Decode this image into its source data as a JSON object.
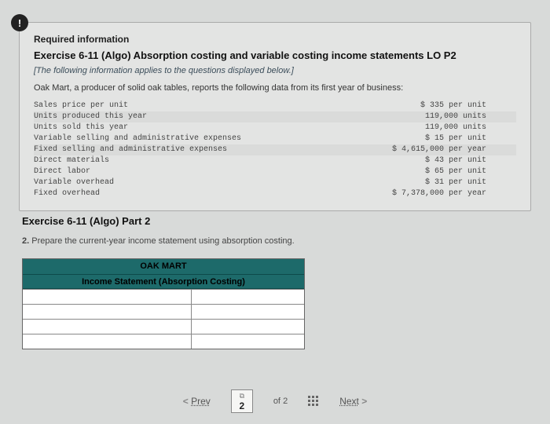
{
  "info": {
    "required": "Required information",
    "title": "Exercise 6-11 (Algo) Absorption costing and variable costing income statements LO P2",
    "note": "[The following information applies to the questions displayed below.]",
    "body": "Oak Mart, a producer of solid oak tables, reports the following data from its first year of business:",
    "rows": [
      {
        "label": "Sales price per unit",
        "value": "$ 335 per unit"
      },
      {
        "label": "Units produced this year",
        "value": "119,000 units"
      },
      {
        "label": "Units sold this year",
        "value": "119,000 units"
      },
      {
        "label": "Variable selling and administrative expenses",
        "value": "$ 15 per unit"
      },
      {
        "label": "Fixed selling and administrative expenses",
        "value": "$ 4,615,000 per year"
      },
      {
        "label": "Direct materials",
        "value": "$ 43 per unit"
      },
      {
        "label": "Direct labor",
        "value": "$ 65 per unit"
      },
      {
        "label": "Variable overhead",
        "value": "$ 31 per unit"
      },
      {
        "label": "Fixed overhead",
        "value": "$ 7,378,000 per year"
      }
    ]
  },
  "part2": {
    "title": "Exercise 6-11 (Algo) Part 2",
    "instruction_prefix": "2. ",
    "instruction": "Prepare the current-year income statement using absorption costing.",
    "ws_header1": "OAK MART",
    "ws_header2": "Income Statement (Absorption Costing)"
  },
  "pager": {
    "prev": "Prev",
    "current": "2",
    "of": "of",
    "total": "2",
    "next": "Next",
    "link_icon": "⧉"
  }
}
